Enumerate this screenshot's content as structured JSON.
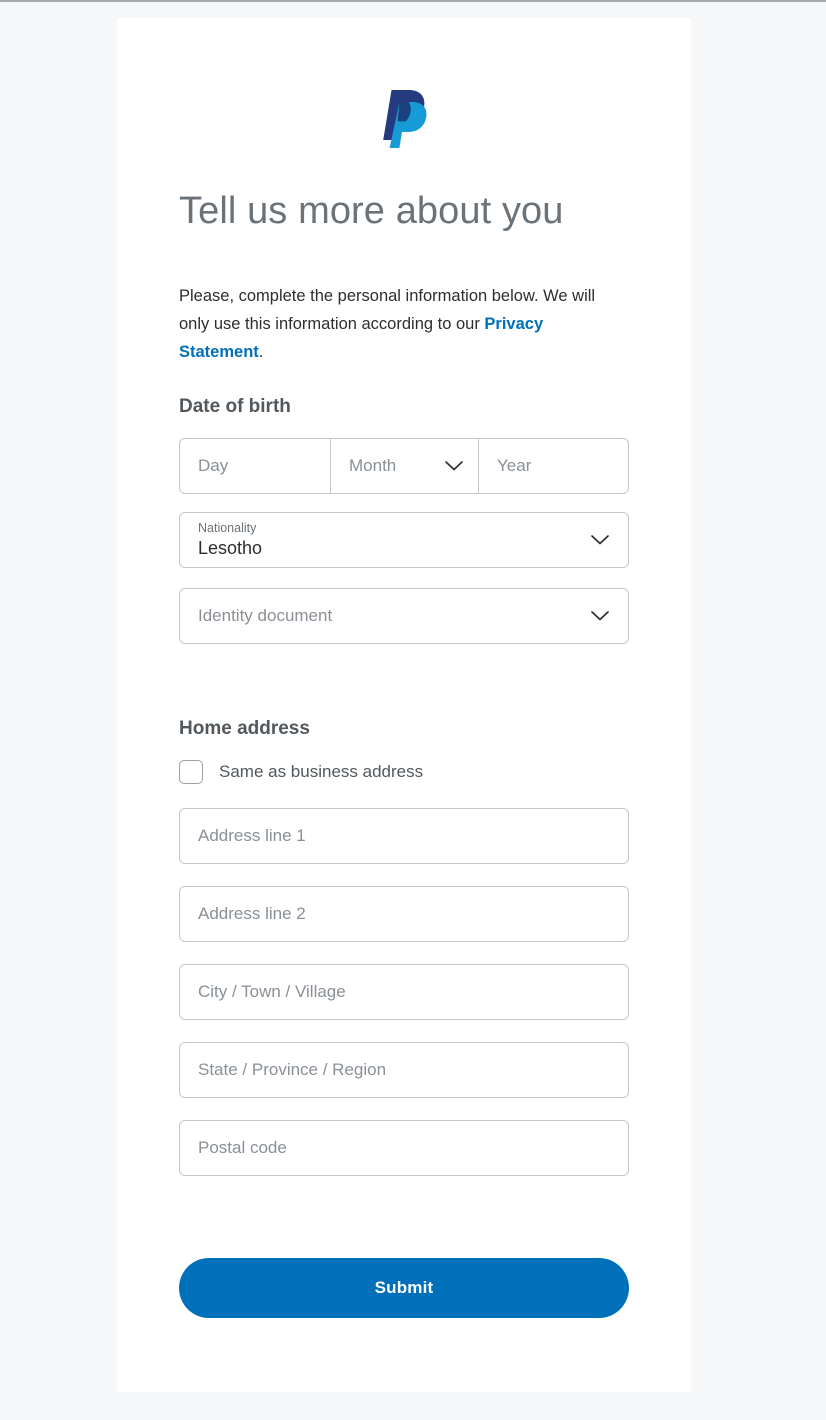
{
  "brand": {
    "logo_name": "paypal-logo",
    "logo_color_dark": "#253b80",
    "logo_color_light": "#179bd7"
  },
  "colors": {
    "page_background": "#f6f7f9",
    "card_background": "#ffffff",
    "accent": "#0070ba",
    "heading": "#6b7278",
    "section_heading": "#53585c",
    "body_text": "#2c2e2f",
    "placeholder": "#8a9096",
    "field_border": "#c6c9cc"
  },
  "header": {
    "title": "Tell us more about you"
  },
  "intro": {
    "text_before": "Please, complete the personal information below. We will only use this information according to our ",
    "link_text": "Privacy Statement",
    "text_after": "."
  },
  "date_of_birth": {
    "section_title": "Date of birth",
    "day": {
      "placeholder": "Day",
      "value": ""
    },
    "month": {
      "placeholder": "Month",
      "value": "",
      "icon": "chevron-down-icon"
    },
    "year": {
      "placeholder": "Year",
      "value": ""
    }
  },
  "nationality": {
    "label": "Nationality",
    "value": "Lesotho",
    "icon": "chevron-down-icon"
  },
  "identity_document": {
    "placeholder": "Identity document",
    "value": "",
    "icon": "chevron-down-icon"
  },
  "home_address": {
    "section_title": "Home address",
    "same_as_business": {
      "label": "Same as business address",
      "checked": false
    },
    "fields": [
      {
        "placeholder": "Address line 1",
        "value": ""
      },
      {
        "placeholder": "Address line 2",
        "value": ""
      },
      {
        "placeholder": "City / Town / Village",
        "value": ""
      },
      {
        "placeholder": "State / Province / Region",
        "value": ""
      },
      {
        "placeholder": "Postal code",
        "value": ""
      }
    ]
  },
  "submit": {
    "label": "Submit"
  }
}
